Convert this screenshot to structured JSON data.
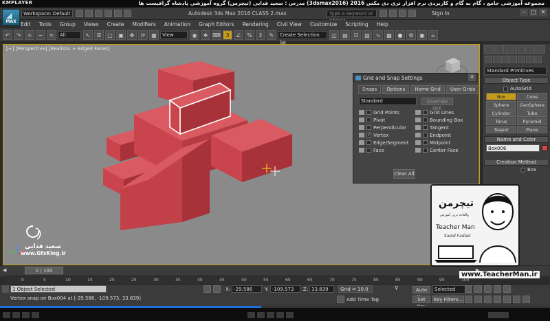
{
  "player": {
    "logo": "KMPLAYER",
    "caption": "مجموعه آموزشی جامع ، گام به گام و کاربردی نرم افزار تری دی مکس 2016 (3dsmax2016) مدرس : سعید فدایی (تیچرمن) گروه آموزشی پادشاه گرافیست ها"
  },
  "titlebar": {
    "logo_text": "MAX",
    "workspace": "Workspace: Default",
    "app_title": "Autodesk 3ds Max 2016     CLASS 2.max",
    "search_placeholder": "Type a keyword or phrase",
    "signin": "Sign In"
  },
  "menu": [
    "Edit",
    "Tools",
    "Group",
    "Views",
    "Create",
    "Modifiers",
    "Animation",
    "Graph Editors",
    "Rendering",
    "Civil View",
    "Customize",
    "Scripting",
    "Help"
  ],
  "toolbar": {
    "filter": "All",
    "refcoord": "View",
    "selset": "Create Selection Se"
  },
  "viewport": {
    "label": "[+] [Perspective] [Realistic + Edged Faces]",
    "colors": {
      "box": "#c9444c",
      "box_side": "#a8323a",
      "selection": "#ffffff"
    }
  },
  "dialog": {
    "title": "Grid and Snap Settings",
    "tabs": [
      "Snaps",
      "Options",
      "Home Grid",
      "User Grids"
    ],
    "preset": "Standard",
    "override": "Override OFF",
    "left_items": [
      {
        "label": "Grid Points",
        "checked": false
      },
      {
        "label": "Pivot",
        "checked": false
      },
      {
        "label": "Perpendicular",
        "checked": false
      },
      {
        "label": "Vertex",
        "checked": true
      },
      {
        "label": "Edge/Segment",
        "checked": false
      },
      {
        "label": "Face",
        "checked": false
      }
    ],
    "right_items": [
      {
        "label": "Grid Lines",
        "checked": false
      },
      {
        "label": "Bounding Box",
        "checked": false
      },
      {
        "label": "Tangent",
        "checked": false
      },
      {
        "label": "Endpoint",
        "checked": false
      },
      {
        "label": "Midpoint",
        "checked": false
      },
      {
        "label": "Center Face",
        "checked": false
      }
    ],
    "clear_all": "Clear All"
  },
  "cmdpanel": {
    "category": "Standard Primitives",
    "object_type": "Object Type",
    "autogrid": "AutoGrid",
    "objects": [
      "Box",
      "Cone",
      "Sphere",
      "GeoSphere",
      "Cylinder",
      "Tube",
      "Torus",
      "Pyramid",
      "Teapot",
      "Plane"
    ],
    "name_color": "Name and Color",
    "object_name": "Box006",
    "object_color": "#d64545",
    "creation_method": "Creation Method",
    "creation_option": "Box"
  },
  "timeline": {
    "slider": "0 / 100",
    "ticks": [
      "0",
      "5",
      "10",
      "15",
      "20",
      "25",
      "30",
      "35",
      "40",
      "45",
      "50",
      "55",
      "60",
      "65",
      "70",
      "75",
      "80",
      "85",
      "90",
      "95",
      "100"
    ]
  },
  "status": {
    "selected": "1 Object Selected",
    "prompt": "Vertex snap on Box004 at [-29.586, -109.573, 33.839]",
    "x_label": "X:",
    "x": "-29.586",
    "y_label": "Y:",
    "y": "-109.573",
    "z_label": "Z:",
    "z": "33.839",
    "grid": "Grid = 10.0",
    "add_time_tag": "Add Time Tag",
    "auto_key": "Auto Key",
    "set_key": "Set Key",
    "key_mode": "Selected",
    "key_filters": "Key Filters..."
  },
  "watermark": {
    "name": "سعید فدایی",
    "site": "www.GfxKing.ir"
  },
  "teacher": {
    "logo": "تیچرمن",
    "sub": "والعاده ترین آموزش",
    "name": "Teacher Man",
    "sign": "Saeid Fadaei",
    "url": "www.TeacherMan.ir"
  }
}
